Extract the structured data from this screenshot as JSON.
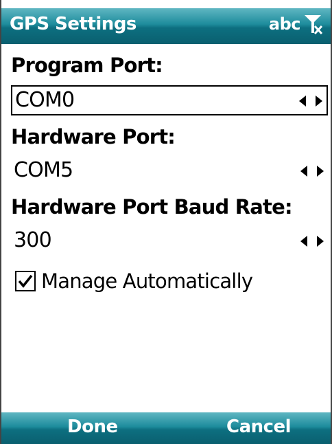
{
  "titlebar": {
    "title": "GPS Settings",
    "input_mode": "abc",
    "status_icon": "no-signal-antenna-icon"
  },
  "form": {
    "program_port": {
      "label": "Program Port:",
      "value": "COM0"
    },
    "hardware_port": {
      "label": "Hardware Port:",
      "value": "COM5"
    },
    "baud_rate": {
      "label": "Hardware Port Baud Rate:",
      "value": "300"
    },
    "manage_auto": {
      "label": "Manage Automatically",
      "checked": true
    }
  },
  "softkeys": {
    "left": "Done",
    "right": "Cancel"
  },
  "colors": {
    "bar_top": "#5fb6c2",
    "bar_bottom": "#0a5f6f"
  }
}
